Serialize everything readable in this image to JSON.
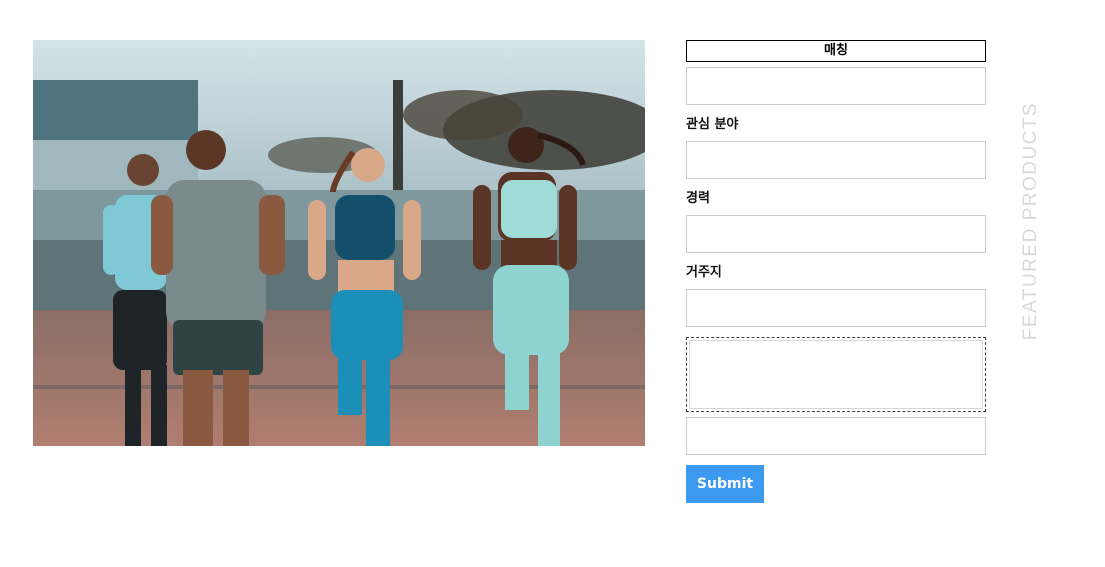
{
  "hero_image": {
    "alt": "Four runners jogging outdoors",
    "icon": "photo-running-group"
  },
  "form": {
    "title": "매칭",
    "field1": {
      "value": "",
      "placeholder": ""
    },
    "interest": {
      "label": "관심 분야",
      "value": "",
      "placeholder": ""
    },
    "career": {
      "label": "경력",
      "value": "",
      "placeholder": ""
    },
    "residence": {
      "label": "거주지",
      "value": "",
      "placeholder": ""
    },
    "message": {
      "value": "",
      "placeholder": ""
    },
    "field_last": {
      "value": "",
      "placeholder": ""
    },
    "submit_label": "Submit"
  },
  "side_heading": "FEATURED PRODUCTS",
  "colors": {
    "submit_bg": "#3b99f0",
    "heading_gray": "#d9d9d9"
  }
}
